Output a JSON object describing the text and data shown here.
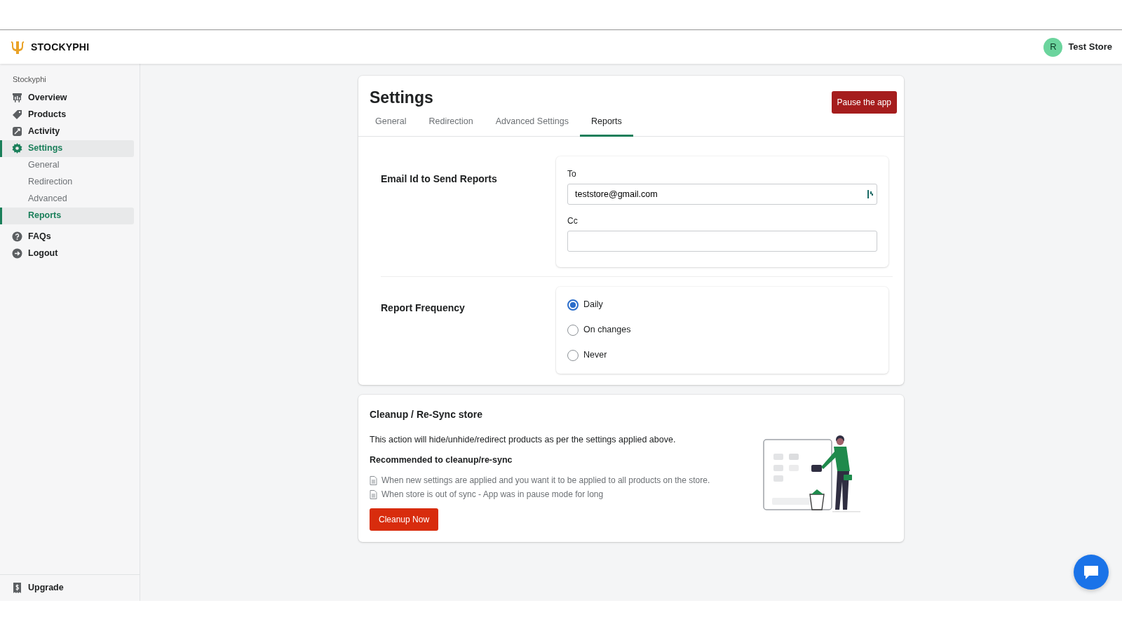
{
  "brand": {
    "name": "STOCKYPHI"
  },
  "account": {
    "initial": "R",
    "name": "Test Store"
  },
  "sidebar": {
    "section": "Stockyphi",
    "items": [
      {
        "label": "Overview",
        "selected": false
      },
      {
        "label": "Products",
        "selected": false
      },
      {
        "label": "Activity",
        "selected": false
      },
      {
        "label": "Settings",
        "selected": true,
        "children": [
          {
            "label": "General",
            "selected": false
          },
          {
            "label": "Redirection",
            "selected": false
          },
          {
            "label": "Advanced",
            "selected": false
          },
          {
            "label": "Reports",
            "selected": true
          }
        ]
      },
      {
        "label": "FAQs",
        "selected": false
      },
      {
        "label": "Logout",
        "selected": false
      }
    ],
    "footer": {
      "label": "Upgrade"
    }
  },
  "settings": {
    "title": "Settings",
    "action": "Pause the app",
    "tabs": [
      {
        "label": "General",
        "selected": false
      },
      {
        "label": "Redirection",
        "selected": false
      },
      {
        "label": "Advanced Settings",
        "selected": false
      },
      {
        "label": "Reports",
        "selected": true
      }
    ],
    "email": {
      "title": "Email Id to Send Reports",
      "fields": [
        {
          "label": "To",
          "value": "teststore@gmail.com"
        },
        {
          "label": "Cc"
        }
      ]
    },
    "frequency": {
      "title": "Report Frequency",
      "options": [
        {
          "label": "Daily",
          "selected": true
        },
        {
          "label": "On changes",
          "selected": false
        },
        {
          "label": "Never",
          "selected": false
        }
      ]
    }
  },
  "cleanup": {
    "title": "Cleanup / Re-Sync store",
    "description": "This action will hide/unhide/redirect products as per the settings applied above.",
    "subtitle": "Recommended to cleanup/re-sync",
    "bullets": [
      "When new settings are applied and you want it to be applied to all products on the store.",
      "When store is out of sync - App was in pause mode for long"
    ],
    "button": "Cleanup Now"
  }
}
